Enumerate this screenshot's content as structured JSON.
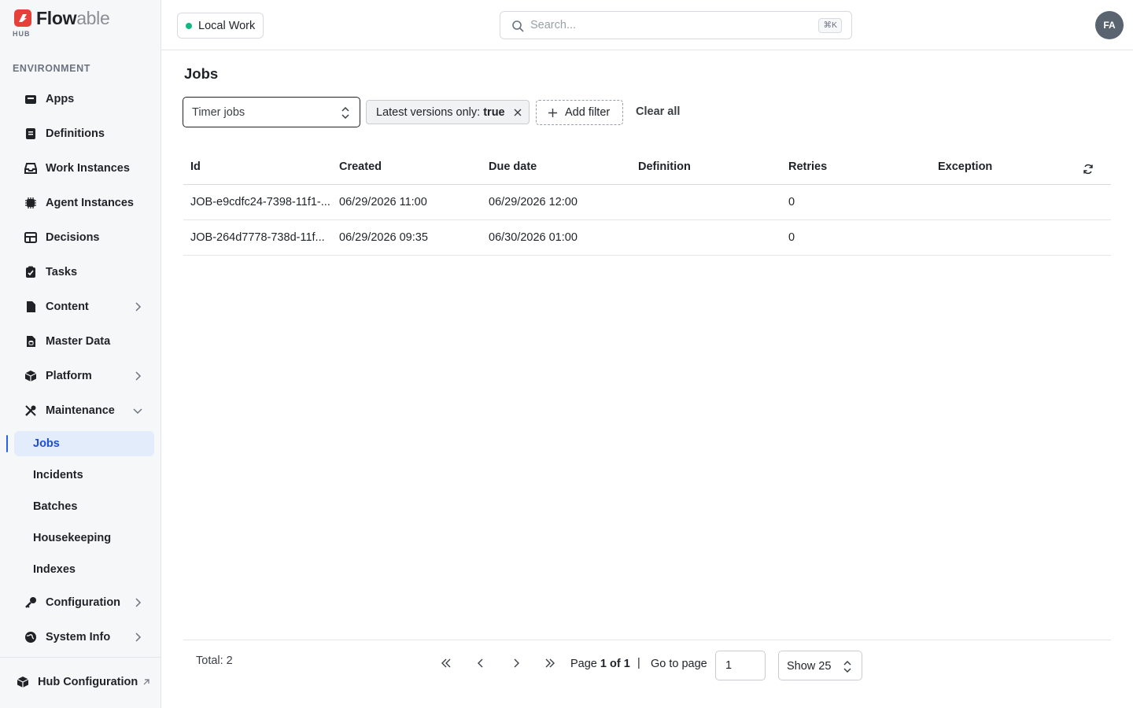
{
  "brand": {
    "name_bold": "Flow",
    "name_light": "able",
    "subtitle": "HUB",
    "accent": "#e5413a"
  },
  "sidebar": {
    "section_label": "ENVIRONMENT",
    "items": [
      {
        "label": "Apps",
        "icon": "box-icon"
      },
      {
        "label": "Definitions",
        "icon": "document-icon"
      },
      {
        "label": "Work Instances",
        "icon": "inbox-icon"
      },
      {
        "label": "Agent Instances",
        "icon": "chip-icon"
      },
      {
        "label": "Decisions",
        "icon": "table-icon"
      },
      {
        "label": "Tasks",
        "icon": "clipboard-check-icon"
      },
      {
        "label": "Content",
        "icon": "file-icon"
      },
      {
        "label": "Master Data",
        "icon": "database-file-icon"
      },
      {
        "label": "Platform",
        "icon": "cube-icon"
      },
      {
        "label": "Maintenance",
        "icon": "tools-icon"
      }
    ],
    "maintenance_sub": [
      {
        "label": "Jobs"
      },
      {
        "label": "Incidents"
      },
      {
        "label": "Batches"
      },
      {
        "label": "Housekeeping"
      },
      {
        "label": "Indexes"
      }
    ],
    "items_after": [
      {
        "label": "Configuration",
        "icon": "key-icon"
      },
      {
        "label": "System Info",
        "icon": "globe-icon"
      }
    ],
    "footer": {
      "label": "Hub Configuration"
    }
  },
  "topbar": {
    "environment": "Local Work",
    "environment_status_color": "#10b981",
    "search_placeholder": "Search...",
    "search_shortcut": "⌘K",
    "avatar_initials": "FA"
  },
  "main": {
    "title": "Jobs",
    "job_type": "Timer jobs",
    "filter_chip": {
      "label": "Latest versions only:",
      "value": "true"
    },
    "add_filter": "Add filter",
    "clear_all": "Clear all",
    "table": {
      "columns": [
        "Id",
        "Created",
        "Due date",
        "Definition",
        "Retries",
        "Exception"
      ],
      "rows": [
        {
          "id": "JOB-e9cdfc24-7398-11f1-...",
          "created": "06/29/2026 11:00",
          "due": "06/29/2026 12:00",
          "definition": "",
          "retries": "0",
          "exception": ""
        },
        {
          "id": "JOB-264d7778-738d-11f...",
          "created": "06/29/2026 09:35",
          "due": "06/30/2026 01:00",
          "definition": "",
          "retries": "0",
          "exception": ""
        }
      ]
    },
    "pagination": {
      "total": "Total: 2",
      "page_prefix": "Page",
      "page_value": "1 of 1",
      "separator": "|",
      "goto_label": "Go to page",
      "goto_value": "1",
      "page_size": "Show 25"
    }
  }
}
